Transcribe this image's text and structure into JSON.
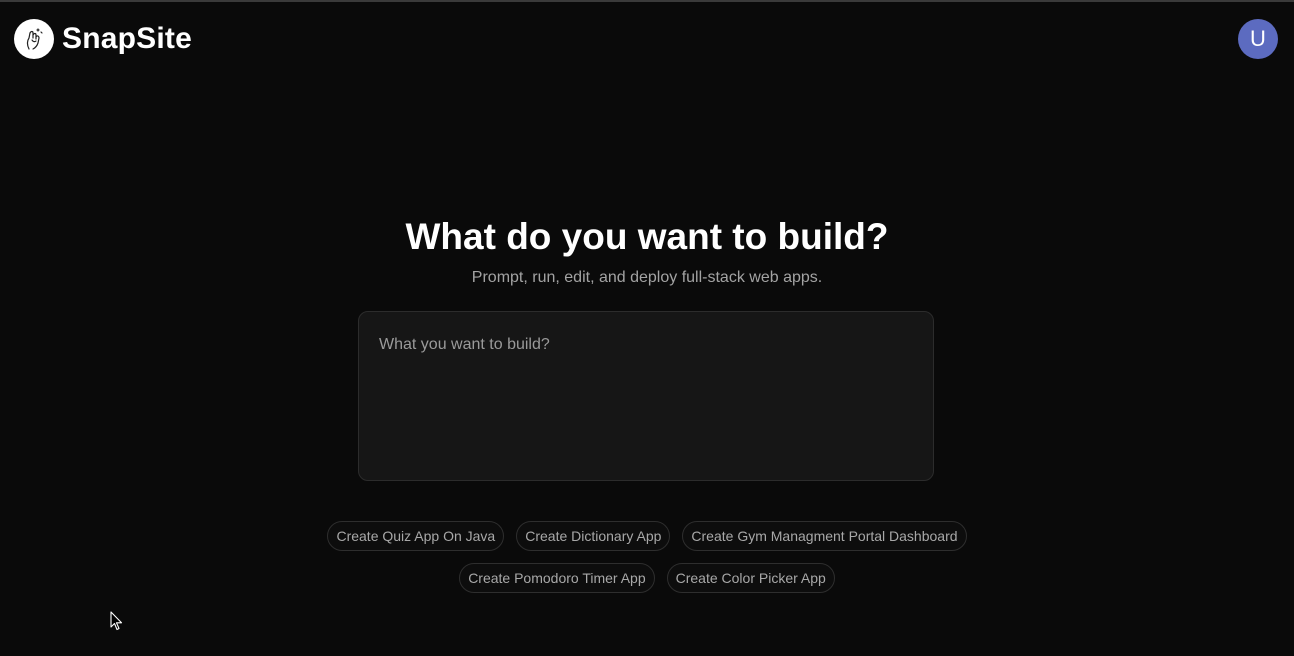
{
  "app": {
    "name": "SnapSite",
    "logo_icon": "hand-sparkle-icon",
    "avatar_initial": "U",
    "avatar_color": "#5c6bc0"
  },
  "hero": {
    "title": "What do you want to build?",
    "subtitle": "Prompt, run, edit, and deploy full-stack web apps."
  },
  "prompt": {
    "placeholder": "What you want to build?",
    "value": ""
  },
  "suggestions": {
    "row1": [
      "Create Quiz App On Java",
      "Create Dictionary App",
      "Create Gym Managment Portal Dashboard"
    ],
    "row2": [
      "Create Pomodoro Timer App",
      "Create Color Picker App"
    ]
  },
  "colors": {
    "background": "#0a0a0a",
    "panel": "#161616",
    "muted_text": "#a3a3a3"
  }
}
